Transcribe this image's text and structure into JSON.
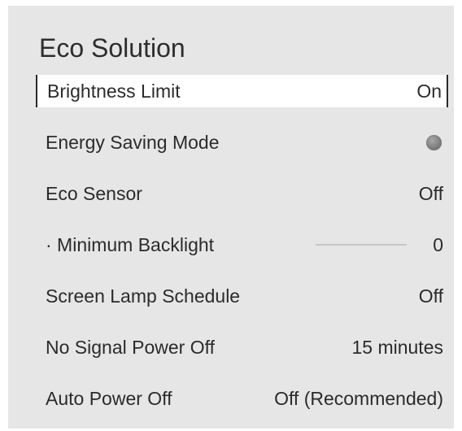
{
  "panel": {
    "title": "Eco Solution",
    "items": [
      {
        "label": "Brightness Limit",
        "value": "On"
      },
      {
        "label": "Energy Saving Mode",
        "icon": "toggle-dot-icon"
      },
      {
        "label": "Eco Sensor",
        "value": "Off"
      },
      {
        "label": "· Minimum Backlight",
        "value": "0",
        "slider_level": 0
      },
      {
        "label": "Screen Lamp Schedule",
        "value": "Off"
      },
      {
        "label": "No Signal Power Off",
        "value": "15 minutes"
      },
      {
        "label": "Auto Power Off",
        "value": "Off (Recommended)"
      }
    ]
  },
  "colors": {
    "panel_bg": "#e6e6e6",
    "selected_bg": "#ffffff",
    "text": "#2b2b2b"
  }
}
